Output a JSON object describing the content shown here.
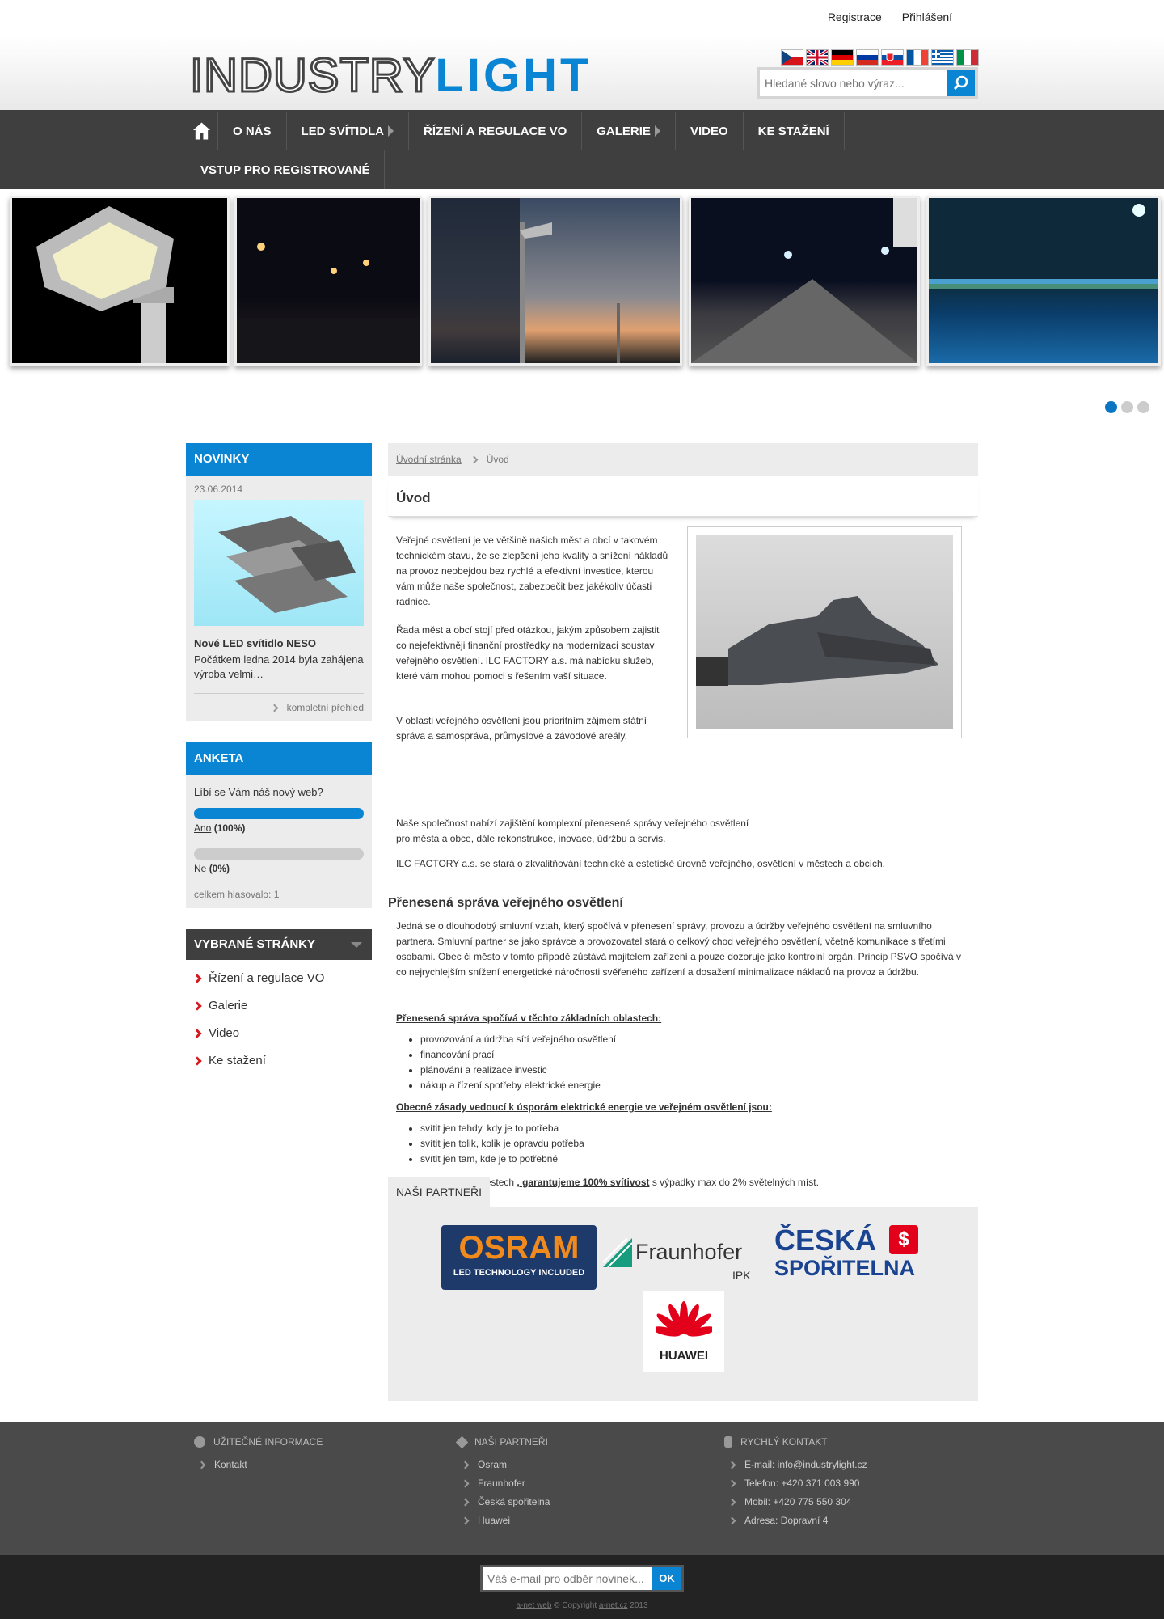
{
  "topbar": {
    "register": "Registrace",
    "login": "Přihlášení"
  },
  "logo": {
    "part1": "INDUSTRY",
    "part2": "LIGHT"
  },
  "languages": [
    "cz",
    "en",
    "de",
    "ru",
    "sk",
    "fr",
    "gr",
    "it"
  ],
  "search": {
    "placeholder": "Hledané slovo nebo výraz..."
  },
  "nav": {
    "items": [
      "O NÁS",
      "LED SVÍTIDLA",
      "ŘÍZENÍ A REGULACE VO",
      "GALERIE",
      "VIDEO",
      "KE STAŽENÍ",
      "VSTUP PRO REGISTROVANÉ"
    ]
  },
  "slider": {
    "active_index": 0,
    "count": 3
  },
  "news": {
    "title": "NOVINKY",
    "date": "23.06.2014",
    "item_title": "Nové LED svítidlo NESO",
    "item_text": "Počátkem ledna 2014 byla zahájena výroba velmi…",
    "more": "kompletní přehled"
  },
  "poll": {
    "title": "ANKETA",
    "question": "Líbí se Vám náš nový web?",
    "answers": [
      {
        "label": "Ano",
        "pct": "(100%)",
        "fraction": 1.0
      },
      {
        "label": "Ne",
        "pct": "(0%)",
        "fraction": 0.0
      }
    ],
    "total": "celkem hlasovalo: 1"
  },
  "selected_pages": {
    "title": "VYBRANÉ STRÁNKY",
    "items": [
      "Řízení a regulace VO",
      "Galerie",
      "Video",
      "Ke stažení"
    ]
  },
  "breadcrumb": {
    "home": "Úvodní stránka",
    "current": "Úvod"
  },
  "page_title": "Úvod",
  "content": {
    "p1": "Veřejné osvětlení je ve většině našich měst a obcí v takovém technickém stavu, že se zlepšení jeho kvality a snížení nákladů na provoz neobejdou bez rychlé a efektivní investice, kterou vám může naše společnost, zabezpečit bez jakékoliv účasti radnice.",
    "p2": "Řada měst a obcí stojí před otázkou, jakým způsobem zajistit co nejefektivněji finanční prostředky na modernizaci soustav veřejného osvětlení. ILC FACTORY a.s. má nabídku služeb, které vám mohou pomoci s řešením vaší situace.",
    "p3": "V oblasti veřejného osvětlení jsou prioritním zájmem státní správa a samospráva, průmyslové a závodové areály.",
    "p4": "Naše společnost nabízí zajištění komplexní přenesené správy veřejného osvětlení pro města a obce, dále rekonstrukce, inovace, údržbu a servis.",
    "p5": "ILC FACTORY a.s. se stará o zkvalitňování technické a estetické úrovně veřejného, osvětlení v městech a obcích.",
    "h2": "Přenesená správa veřejného osvětlení",
    "p6": "Jedná se o dlouhodobý smluvní vztah, který spočívá v přenesení správy, provozu a údržby veřejného osvětlení na smluvního partnera. Smluvní partner se jako správce a provozovatel stará o celkový chod veřejného osvětlení, včetně komunikace s třetími osobami. Obec či město v tomto případě zůstává majitelem zařízení a pouze dozoruje jako kontrolní orgán. Princip PSVO spočívá v co nejrychlejším snížení energetické náročnosti svěřeného zařízení a dosažení minimalizace nákladů na provoz a údržbu.",
    "list1_head": "Přenesená správa spočívá v těchto základních oblastech:",
    "list1": [
      "provozování a údržba sítí veřejného osvětlení",
      "financování prací",
      "plánování a realizace investic",
      "nákup a řízení spotřeby elektrické energie"
    ],
    "list2_head": "Obecné zásady vedoucí k úsporám elektrické energie ve veřejném osvětlení jsou:",
    "list2": [
      "svítit jen tehdy, kdy je to potřeba",
      "svítit jen tolik, kolik je opravdu potřeba",
      "svítit jen tam, kde je to potřebné"
    ],
    "final_pre": "Ve všech obcích a městech ",
    "final_bold": ", garantujeme 100% svítivost",
    "final_post": " s výpadky max  do 2% světelných míst."
  },
  "partners": {
    "title": "NAŠI PARTNEŘI",
    "osram": "OSRAM",
    "osram_sub": "LED TECHNOLOGY INCLUDED",
    "fraunhofer": "Fraunhofer",
    "fraunhofer_sub": "IPK",
    "cs1": "ČESKÁ",
    "cs2": "SPOŘITELNA",
    "huawei": "HUAWEI"
  },
  "footer": {
    "col1_title": "UŽITEČNÉ INFORMACE",
    "col1_items": [
      "Kontakt"
    ],
    "col2_title": "NAŠI PARTNEŘI",
    "col2_items": [
      "Osram",
      "Fraunhofer",
      "Česká spořitelna",
      "Huawei"
    ],
    "col3_title": "RYCHLÝ KONTAKT",
    "col3_items": [
      "E-mail: info@industrylight.cz",
      "Telefon: +420 371 003 990",
      "Mobil: +420 775 550 304",
      "Adresa: Dopravní 4"
    ]
  },
  "newsletter": {
    "placeholder": "Váš e-mail pro odběr novinek...",
    "button": "OK"
  },
  "copyright": {
    "link1": "a-net web",
    "text": " © Copyright ",
    "link2": "a-net.cz",
    "year": " 2013"
  }
}
